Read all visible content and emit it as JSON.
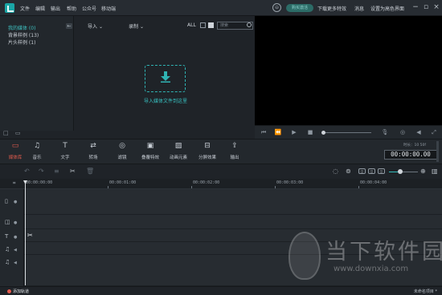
{
  "menubar": {
    "items": [
      "文件",
      "编辑",
      "输出",
      "帮助",
      "公众号",
      "移动端"
    ],
    "buy_label": "购买激活",
    "links": [
      "下载更多特效",
      "消息",
      "设置为高色界面"
    ]
  },
  "media_library": {
    "folders": [
      {
        "label": "我的媒体 (0)",
        "active": true
      },
      {
        "label": "背景样例 (13)",
        "active": false
      },
      {
        "label": "片头样例 (1)",
        "active": false
      }
    ],
    "import_label": "导入",
    "record_label": "录制",
    "all_label": "ALL",
    "search_placeholder": "搜索",
    "drop_label": "导入媒体文件到这里"
  },
  "toolbar": {
    "tools": [
      {
        "label": "媒体库",
        "icon": "folder-icon",
        "active": true
      },
      {
        "label": "音乐",
        "icon": "music-icon",
        "active": false
      },
      {
        "label": "文字",
        "icon": "text-icon",
        "active": false
      },
      {
        "label": "转场",
        "icon": "transition-icon",
        "active": false
      },
      {
        "label": "滤镜",
        "icon": "filter-icon",
        "active": false
      },
      {
        "label": "叠覆特效",
        "icon": "overlay-icon",
        "active": false
      },
      {
        "label": "动画元素",
        "icon": "element-icon",
        "active": false
      },
      {
        "label": "分屏效果",
        "icon": "splitscreen-icon",
        "active": false
      },
      {
        "label": "输出",
        "icon": "export-icon",
        "active": false
      }
    ],
    "duration_label": "时长：10 50f",
    "timecode": "00:00:00.00"
  },
  "timeline": {
    "ruler_labels": [
      "00:00:00:00",
      "00:00:01:00",
      "00:00:02:00",
      "00:00:03:00",
      "00:00:04:00"
    ]
  },
  "statusbar": {
    "add_track": "添加轨道",
    "project_name": "未命名项目 *"
  },
  "watermark": {
    "text": "当下软件园",
    "url": "www.downxia.com"
  },
  "colors": {
    "accent": "#2fb3b3",
    "active_tool": "#e55c4e",
    "background": "#1f2328"
  }
}
